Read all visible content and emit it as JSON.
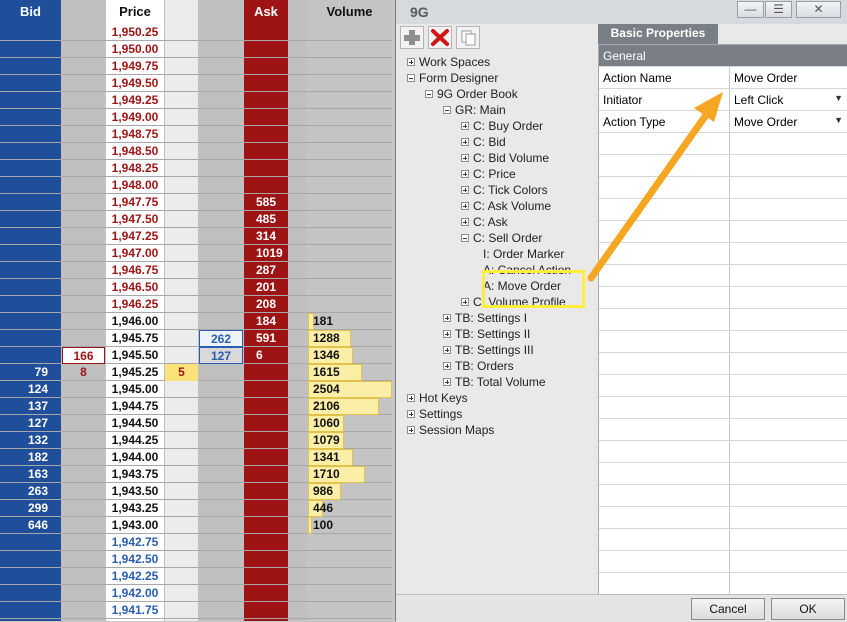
{
  "book": {
    "headers": {
      "bid": "Bid",
      "price": "Price",
      "ask": "Ask",
      "volume": "Volume"
    },
    "rows": [
      {
        "price": "1,950.25",
        "ask": "",
        "bid": "",
        "vol": "",
        "side": "ask"
      },
      {
        "price": "1,950.00",
        "ask": "",
        "bid": "",
        "vol": "",
        "side": "ask"
      },
      {
        "price": "1,949.75",
        "ask": "",
        "bid": "",
        "vol": "",
        "side": "ask"
      },
      {
        "price": "1,949.50",
        "ask": "",
        "bid": "",
        "vol": "",
        "side": "ask"
      },
      {
        "price": "1,949.25",
        "ask": "",
        "bid": "",
        "vol": "",
        "side": "ask"
      },
      {
        "price": "1,949.00",
        "ask": "",
        "bid": "",
        "vol": "",
        "side": "ask"
      },
      {
        "price": "1,948.75",
        "ask": "",
        "bid": "",
        "vol": "",
        "side": "ask"
      },
      {
        "price": "1,948.50",
        "ask": "",
        "bid": "",
        "vol": "",
        "side": "ask"
      },
      {
        "price": "1,948.25",
        "ask": "",
        "bid": "",
        "vol": "",
        "side": "ask"
      },
      {
        "price": "1,948.00",
        "ask": "",
        "bid": "",
        "vol": "",
        "side": "ask"
      },
      {
        "price": "1,947.75",
        "ask": "585",
        "bid": "",
        "vol": "",
        "side": "ask"
      },
      {
        "price": "1,947.50",
        "ask": "485",
        "bid": "",
        "vol": "",
        "side": "ask"
      },
      {
        "price": "1,947.25",
        "ask": "314",
        "bid": "",
        "vol": "",
        "side": "ask"
      },
      {
        "price": "1,947.00",
        "ask": "1019",
        "bid": "",
        "vol": "",
        "side": "ask"
      },
      {
        "price": "1,946.75",
        "ask": "287",
        "bid": "",
        "vol": "",
        "side": "ask"
      },
      {
        "price": "1,946.50",
        "ask": "201",
        "bid": "",
        "vol": "",
        "side": "ask"
      },
      {
        "price": "1,946.25",
        "ask": "208",
        "bid": "",
        "vol": "",
        "side": "ask"
      },
      {
        "price": "1,946.00",
        "ask": "184",
        "bid": "",
        "vol": "181",
        "side": "mid"
      },
      {
        "price": "1,945.75",
        "ask": "591",
        "bid": "",
        "vol": "1288",
        "side": "mid",
        "sellorder": "262"
      },
      {
        "price": "1,945.50",
        "ask": "6",
        "bid": "",
        "vol": "1346",
        "side": "mid",
        "buyorder": "166",
        "sellorder2": "127"
      },
      {
        "price": "1,945.25",
        "ask": "",
        "bid": "79",
        "vol": "1615",
        "side": "mid",
        "buyorder2": "8",
        "mark": "5"
      },
      {
        "price": "1,945.00",
        "ask": "",
        "bid": "124",
        "vol": "2504",
        "side": "mid"
      },
      {
        "price": "1,944.75",
        "ask": "",
        "bid": "137",
        "vol": "2106",
        "side": "mid"
      },
      {
        "price": "1,944.50",
        "ask": "",
        "bid": "127",
        "vol": "1060",
        "side": "mid"
      },
      {
        "price": "1,944.25",
        "ask": "",
        "bid": "132",
        "vol": "1079",
        "side": "mid"
      },
      {
        "price": "1,944.00",
        "ask": "",
        "bid": "182",
        "vol": "1341",
        "side": "mid"
      },
      {
        "price": "1,943.75",
        "ask": "",
        "bid": "163",
        "vol": "1710",
        "side": "mid"
      },
      {
        "price": "1,943.50",
        "ask": "",
        "bid": "263",
        "vol": "986",
        "side": "mid"
      },
      {
        "price": "1,943.25",
        "ask": "",
        "bid": "299",
        "vol": "446",
        "side": "mid"
      },
      {
        "price": "1,943.00",
        "ask": "",
        "bid": "646",
        "vol": "100",
        "side": "mid"
      },
      {
        "price": "1,942.75",
        "ask": "",
        "bid": "",
        "vol": "",
        "side": "bid"
      },
      {
        "price": "1,942.50",
        "ask": "",
        "bid": "",
        "vol": "",
        "side": "bid"
      },
      {
        "price": "1,942.25",
        "ask": "",
        "bid": "",
        "vol": "",
        "side": "bid"
      },
      {
        "price": "1,942.00",
        "ask": "",
        "bid": "",
        "vol": "",
        "side": "bid"
      },
      {
        "price": "1,941.75",
        "ask": "",
        "bid": "",
        "vol": "",
        "side": "bid"
      }
    ],
    "colors": {
      "bid": "#1f4e9a",
      "ask": "#9e1414",
      "askPrice": "#9e1414",
      "bidPrice": "#2a5db0",
      "volBar": "#fbeea6"
    }
  },
  "dialog": {
    "title": "9G",
    "window_buttons": {
      "minimize": "—",
      "restore": "☰",
      "close": "✕"
    },
    "tab_label": "Basic Properties",
    "tree": [
      {
        "label": "Work Spaces",
        "depth": 0,
        "exp": "plus"
      },
      {
        "label": "Form Designer",
        "depth": 0,
        "exp": "minus"
      },
      {
        "label": "9G Order Book",
        "depth": 1,
        "exp": "minus"
      },
      {
        "label": "GR: Main",
        "depth": 2,
        "exp": "minus"
      },
      {
        "label": "C: Buy Order",
        "depth": 3,
        "exp": "plus"
      },
      {
        "label": "C: Bid",
        "depth": 3,
        "exp": "plus"
      },
      {
        "label": "C: Bid Volume",
        "depth": 3,
        "exp": "plus"
      },
      {
        "label": "C: Price",
        "depth": 3,
        "exp": "plus"
      },
      {
        "label": "C: Tick Colors",
        "depth": 3,
        "exp": "plus"
      },
      {
        "label": "C: Ask Volume",
        "depth": 3,
        "exp": "plus"
      },
      {
        "label": "C: Ask",
        "depth": 3,
        "exp": "plus"
      },
      {
        "label": "C: Sell Order",
        "depth": 3,
        "exp": "minus"
      },
      {
        "label": "I: Order Marker",
        "depth": 4,
        "exp": ""
      },
      {
        "label": "A: Cancel Action",
        "depth": 4,
        "exp": ""
      },
      {
        "label": "A: Move Order",
        "depth": 4,
        "exp": ""
      },
      {
        "label": "C: Volume Profile",
        "depth": 3,
        "exp": "plus"
      },
      {
        "label": "TB: Settings I",
        "depth": 2,
        "exp": "plus"
      },
      {
        "label": "TB: Settings II",
        "depth": 2,
        "exp": "plus"
      },
      {
        "label": "TB: Settings III",
        "depth": 2,
        "exp": "plus"
      },
      {
        "label": "TB: Orders",
        "depth": 2,
        "exp": "plus"
      },
      {
        "label": "TB: Total Volume",
        "depth": 2,
        "exp": "plus"
      },
      {
        "label": "Hot Keys",
        "depth": 0,
        "exp": "plus"
      },
      {
        "label": "Settings",
        "depth": 0,
        "exp": "plus"
      },
      {
        "label": "Session Maps",
        "depth": 0,
        "exp": "plus"
      }
    ],
    "properties": {
      "category": "General",
      "rows": [
        {
          "key": "Action Name",
          "value": "Move Order",
          "dropdown": false
        },
        {
          "key": "Initiator",
          "value": "Left Click",
          "dropdown": true
        },
        {
          "key": "Action Type",
          "value": "Move Order",
          "dropdown": true
        }
      ]
    },
    "footer": {
      "cancel": "Cancel",
      "ok": "OK"
    },
    "accent": {
      "highlight": "#ffef3a",
      "arrow": "#f5a623"
    }
  }
}
